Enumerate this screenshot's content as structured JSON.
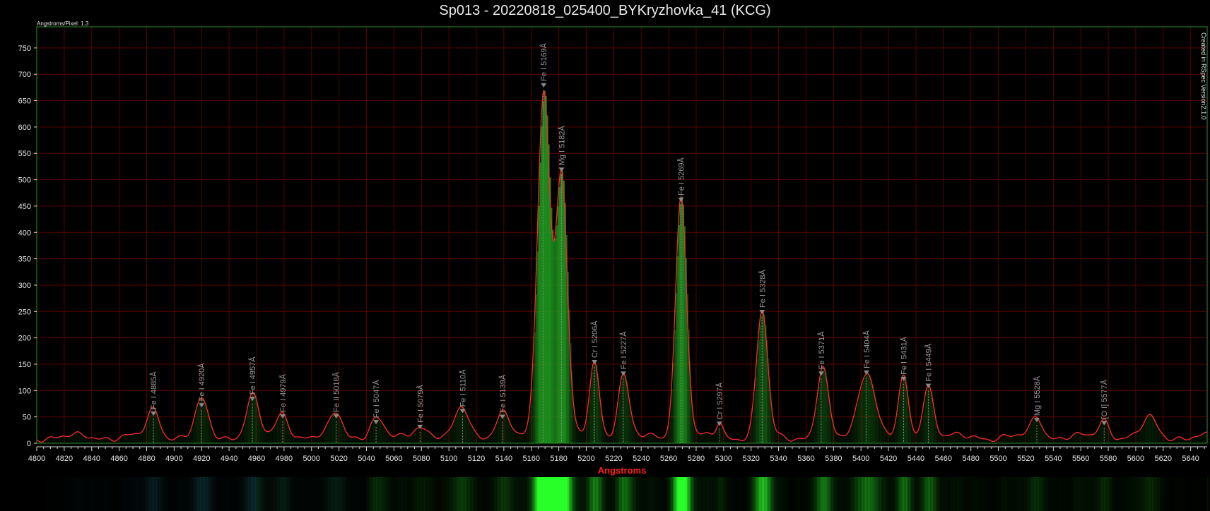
{
  "title": "Sp013 - 20220818_025400_BYKryzhovka_41 (KCG)",
  "scale_note": "Angstroms/Pixel: 1.3",
  "created_note": "Created in RSpec Version2.1.0",
  "colors": {
    "background": "#000000",
    "grid": "#5a0000",
    "spectrum": "#ff2a2a",
    "fill": "#1f9a1f",
    "frame": "#2e8b2e",
    "xlabel": "#ff2020"
  },
  "chart_data": {
    "type": "line",
    "title": "Sp013 - 20220818_025400_BYKryzhovka_41 (KCG)",
    "xlabel": "Angstroms",
    "ylabel": "",
    "xlim": [
      4800,
      5650
    ],
    "ylim": [
      0,
      790
    ],
    "grid": true,
    "x_ticks": [
      4800,
      4820,
      4840,
      4860,
      4880,
      4900,
      4920,
      4940,
      4960,
      4980,
      5000,
      5020,
      5040,
      5060,
      5080,
      5100,
      5120,
      5140,
      5160,
      5180,
      5200,
      5220,
      5240,
      5260,
      5280,
      5300,
      5320,
      5340,
      5360,
      5380,
      5400,
      5420,
      5440,
      5460,
      5480,
      5500,
      5520,
      5540,
      5560,
      5580,
      5600,
      5620,
      5640
    ],
    "y_ticks": [
      0,
      50,
      100,
      150,
      200,
      250,
      300,
      350,
      400,
      450,
      500,
      550,
      600,
      650,
      700,
      750
    ],
    "peaks": [
      {
        "x": 4885,
        "y": 52,
        "w": 4.5
      },
      {
        "x": 4920,
        "y": 68,
        "w": 4.5
      },
      {
        "x": 4957,
        "y": 78,
        "w": 4.5
      },
      {
        "x": 4979,
        "y": 45,
        "w": 4.5
      },
      {
        "x": 5018,
        "y": 45,
        "w": 4.5
      },
      {
        "x": 5047,
        "y": 35,
        "w": 4.5
      },
      {
        "x": 5079,
        "y": 25,
        "w": 4.5
      },
      {
        "x": 5110,
        "y": 55,
        "w": 5
      },
      {
        "x": 5139,
        "y": 45,
        "w": 5
      },
      {
        "x": 5169,
        "y": 660,
        "w": 4.5
      },
      {
        "x": 5182,
        "y": 495,
        "w": 4.2
      },
      {
        "x": 5206,
        "y": 145,
        "w": 3.5
      },
      {
        "x": 5227,
        "y": 120,
        "w": 4
      },
      {
        "x": 5269,
        "y": 455,
        "w": 4
      },
      {
        "x": 5297,
        "y": 28,
        "w": 2.5
      },
      {
        "x": 5328,
        "y": 238,
        "w": 4
      },
      {
        "x": 5372,
        "y": 130,
        "w": 4
      },
      {
        "x": 5404,
        "y": 128,
        "w": 6
      },
      {
        "x": 5431,
        "y": 112,
        "w": 3.5
      },
      {
        "x": 5449,
        "y": 98,
        "w": 4
      },
      {
        "x": 5528,
        "y": 40,
        "w": 4
      },
      {
        "x": 5577,
        "y": 32,
        "w": 4
      },
      {
        "x": 5610,
        "y": 35,
        "w": 5
      }
    ],
    "baseline": 12,
    "lines": [
      {
        "label": "Fe I 4885Å",
        "x": 4885,
        "y": 52
      },
      {
        "label": "Fe I 4920Å",
        "x": 4920,
        "y": 68
      },
      {
        "label": "Fe I 4957Å",
        "x": 4957,
        "y": 80
      },
      {
        "label": "Fe I 4979Å",
        "x": 4979,
        "y": 47
      },
      {
        "label": "Fe II 5018Å",
        "x": 5018,
        "y": 47
      },
      {
        "label": "Fe I 5047Å",
        "x": 5047,
        "y": 36
      },
      {
        "label": "Fe I 5079Å",
        "x": 5079,
        "y": 27
      },
      {
        "label": "Fe I 5110Å",
        "x": 5110,
        "y": 57
      },
      {
        "label": "Fe I 5139Å",
        "x": 5139,
        "y": 46
      },
      {
        "label": "Fe I 5169Å",
        "x": 5169,
        "y": 675
      },
      {
        "label": "Mg I 5182Å",
        "x": 5182,
        "y": 515
      },
      {
        "label": "Cr I 5206Å",
        "x": 5206,
        "y": 150
      },
      {
        "label": "Fe I 5227Å",
        "x": 5227,
        "y": 128
      },
      {
        "label": "Fe I 5269Å",
        "x": 5269,
        "y": 458
      },
      {
        "label": "Cr I 5297Å",
        "x": 5297,
        "y": 33
      },
      {
        "label": "Fe I 5328Å",
        "x": 5328,
        "y": 245
      },
      {
        "label": "Fe I 5371Å",
        "x": 5371,
        "y": 128
      },
      {
        "label": "Fe I 5404Å",
        "x": 5404,
        "y": 130
      },
      {
        "label": "Fe I 5431Å",
        "x": 5431,
        "y": 118
      },
      {
        "label": "Fe I 5449Å",
        "x": 5449,
        "y": 105
      },
      {
        "label": "Mg I 5528Å",
        "x": 5528,
        "y": 40
      },
      {
        "label": "[O I] 5577Å",
        "x": 5577,
        "y": 34
      }
    ]
  }
}
